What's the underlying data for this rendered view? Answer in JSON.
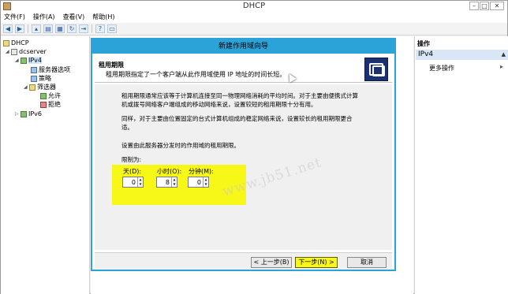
{
  "window": {
    "title": "DHCP"
  },
  "menu": [
    "文件(F)",
    "操作(A)",
    "查看(V)",
    "帮助(H)"
  ],
  "toolbar": {
    "icons": [
      "back-arrow-icon",
      "forward-arrow-icon",
      "folder-up-icon",
      "console-tree-icon",
      "properties-icon",
      "refresh-icon",
      "export-icon",
      "help-icon",
      "monitor-icon"
    ]
  },
  "tree": {
    "root": "DHCP",
    "server": "dcserver",
    "ipv4": "IPv4",
    "server_options": "服务器选项",
    "policies": "策略",
    "filters": "筛选器",
    "allow": "允许",
    "deny": "拒绝",
    "ipv6": "IPv6"
  },
  "actions": {
    "title": "操作",
    "section": "IPv4",
    "more": "更多操作"
  },
  "dialog": {
    "title": "新建作用域向导",
    "header_title": "租用期限",
    "header_sub": "租用期限指定了一个客户端从此作用域使用 IP 地址的时间长短。",
    "para1_line1": "租用期限通常应该等于计算机连接至同一物理网络消耗的平均时间。对于主要由便携式计算",
    "para1_line2": "机或拨号网络客户端组成的移动网络来说，设置较短的租用期限十分有用。",
    "para2_line1": "同样，对于主要由位置固定的台式计算机组成的稳定网络来说，设置较长的租用期限更合",
    "para2_line2": "适。",
    "prompt": "设置由此服务器分发时的作用域的租用期限。",
    "limit_label": "限制为:",
    "days_label": "天(D):",
    "hours_label": "小时(O):",
    "minutes_label": "分钟(M):",
    "days_value": "0",
    "hours_value": "8",
    "minutes_value": "0",
    "back_button": "< 上一步(B)",
    "next_button": "下一步(N) >",
    "cancel_button": "取消"
  },
  "watermark": "www.jb51.net",
  "colors": {
    "dialog_accent": "#2ba3d9",
    "highlight": "#f7f718",
    "header_icon": "#1b3070"
  }
}
